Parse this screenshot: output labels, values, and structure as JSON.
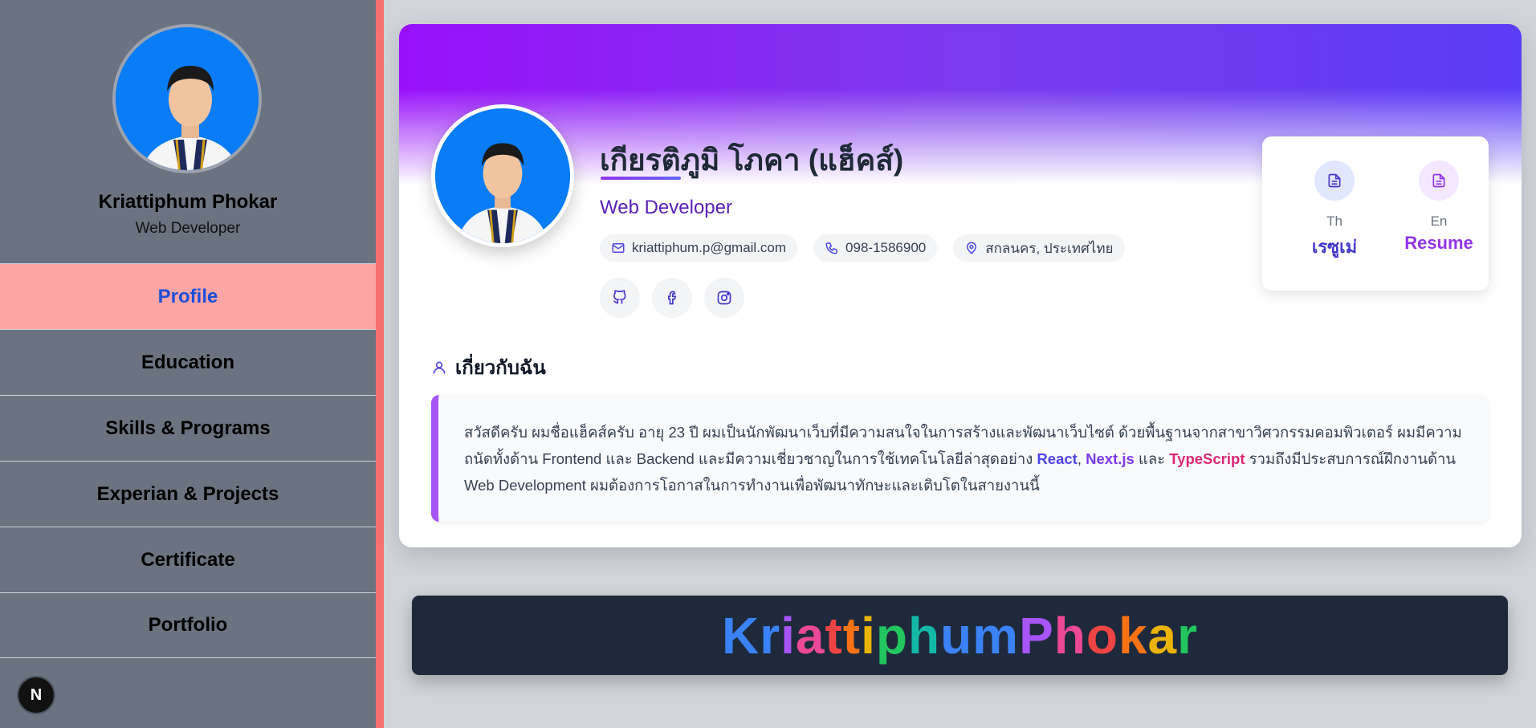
{
  "sidebar": {
    "name": "Kriattiphum Phokar",
    "role": "Web Developer",
    "nav": [
      {
        "label": "Profile",
        "active": true
      },
      {
        "label": "Education",
        "active": false
      },
      {
        "label": "Skills & Programs",
        "active": false
      },
      {
        "label": "Experian & Projects",
        "active": false
      },
      {
        "label": "Certificate",
        "active": false
      },
      {
        "label": "Portfolio",
        "active": false
      }
    ],
    "badge": "N"
  },
  "profile": {
    "name": "เกียรติภูมิ โภคา (แฮ็คส์)",
    "role": "Web Developer",
    "email": "kriattiphum.p@gmail.com",
    "phone": "098-1586900",
    "location": "สกลนคร, ประเทศไทย",
    "socials": [
      "github-icon",
      "facebook-icon",
      "instagram-icon"
    ]
  },
  "resume": {
    "th": {
      "lang": "Th",
      "label": "เรซูเม่"
    },
    "en": {
      "lang": "En",
      "label": "Resume"
    }
  },
  "about": {
    "heading": "เกี่ยวกับฉัน",
    "text_1": "สวัสดีครับ ผมชื่อแฮ็คส์ครับ อายุ 23 ปี ผมเป็นนักพัฒนาเว็บที่มีความสนใจในการสร้างและพัฒนาเว็บไซต์ ด้วยพื้นฐานจากสาขาวิศวกรรมคอมพิวเตอร์ ผมมีความถนัดทั้งด้าน Frontend และ Backend และมีความเชี่ยวชาญในการใช้เทคโนโลยีล่าสุดอย่าง ",
    "kw_react": "React",
    "sep_1": ", ",
    "kw_next": "Next.js",
    "sep_2": " และ ",
    "kw_ts": "TypeScript",
    "text_2": " รวมถึงมีประสบการณ์ฝึกงานด้าน Web Development ผมต้องการโอกาสในการทำงานเพื่อพัฒนาทักษะและเติบโตในสายงานนี้"
  },
  "footer": {
    "letters": [
      "K",
      "r",
      "i",
      "a",
      "t",
      "t",
      "i",
      "p",
      "h",
      "u",
      "m",
      "P",
      "h",
      "o",
      "k",
      "a",
      "r"
    ],
    "colors": [
      "#3b82f6",
      "#3b82f6",
      "#a855f7",
      "#ec4899",
      "#ef4444",
      "#f97316",
      "#eab308",
      "#22c55e",
      "#14b8a6",
      "#3b82f6",
      "#3b82f6",
      "#a855f7",
      "#ec4899",
      "#ef4444",
      "#f97316",
      "#eab308",
      "#22c55e"
    ]
  }
}
